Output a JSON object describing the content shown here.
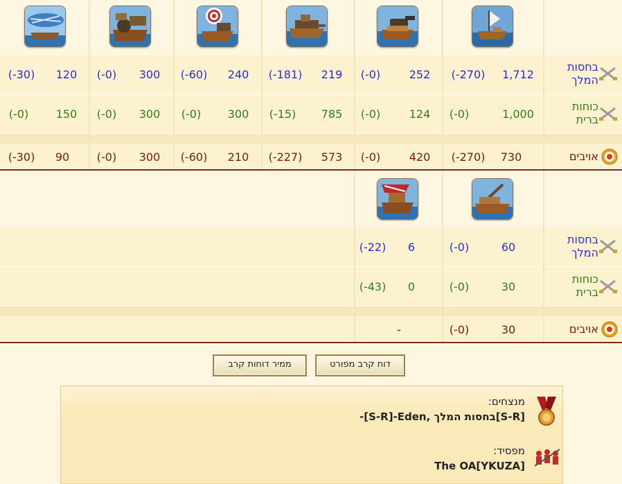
{
  "row_labels": {
    "royal_guard": "בחסות המלך",
    "allied": "כוחות ברית",
    "enemies": "אויבים"
  },
  "section1": {
    "units": [
      "cargo-ship-icon",
      "cannon-ship-icon",
      "ram-ship-icon",
      "ballista-ship-icon",
      "mortar-ship-icon",
      "balloon-carrier-icon"
    ],
    "royal_guard": [
      {
        "val": "1,712",
        "loss": "(-270)"
      },
      {
        "val": "252",
        "loss": "(-0)"
      },
      {
        "val": "219",
        "loss": "(-181)"
      },
      {
        "val": "240",
        "loss": "(-60)"
      },
      {
        "val": "300",
        "loss": "(-0)"
      },
      {
        "val": "120",
        "loss": "(-30)"
      }
    ],
    "allied": [
      {
        "val": "1,000",
        "loss": "(-0)"
      },
      {
        "val": "124",
        "loss": "(-0)"
      },
      {
        "val": "785",
        "loss": "(-15)"
      },
      {
        "val": "300",
        "loss": "(-0)"
      },
      {
        "val": "300",
        "loss": "(-0)"
      },
      {
        "val": "150",
        "loss": "(-0)"
      }
    ],
    "enemies": [
      {
        "val": "730",
        "loss": "(-270)"
      },
      {
        "val": "420",
        "loss": "(-0)"
      },
      {
        "val": "573",
        "loss": "(-227)"
      },
      {
        "val": "210",
        "loss": "(-60)"
      },
      {
        "val": "300",
        "loss": "(-0)"
      },
      {
        "val": "90",
        "loss": "(-30)"
      }
    ]
  },
  "section2": {
    "units": [
      "catapult-ship-icon",
      "fire-ship-icon"
    ],
    "royal_guard": [
      {
        "val": "60",
        "loss": "(-0)"
      },
      {
        "val": "6",
        "loss": "(-22)"
      }
    ],
    "allied": [
      {
        "val": "30",
        "loss": "(-0)"
      },
      {
        "val": "0",
        "loss": "(-43)"
      }
    ],
    "enemies": [
      {
        "val": "30",
        "loss": "(-0)"
      },
      {
        "val": "-",
        "loss": ""
      }
    ]
  },
  "buttons": {
    "detailed_report": "דוח קרב מפורט",
    "report_converter": "ממיר דוחות קרב"
  },
  "result": {
    "winners_label": "מנצחים:",
    "winners_value": "-[S-R]-Eden, בחסות המלך[S-R]",
    "loser_label": "מפסיד:",
    "loser_value": "The OA[YKUZA]"
  },
  "colors": {
    "royal_guard": "#2b2bd9",
    "allied": "#2e7d1e",
    "enemies": "#7a1a0a",
    "divider": "#7d2a18"
  }
}
